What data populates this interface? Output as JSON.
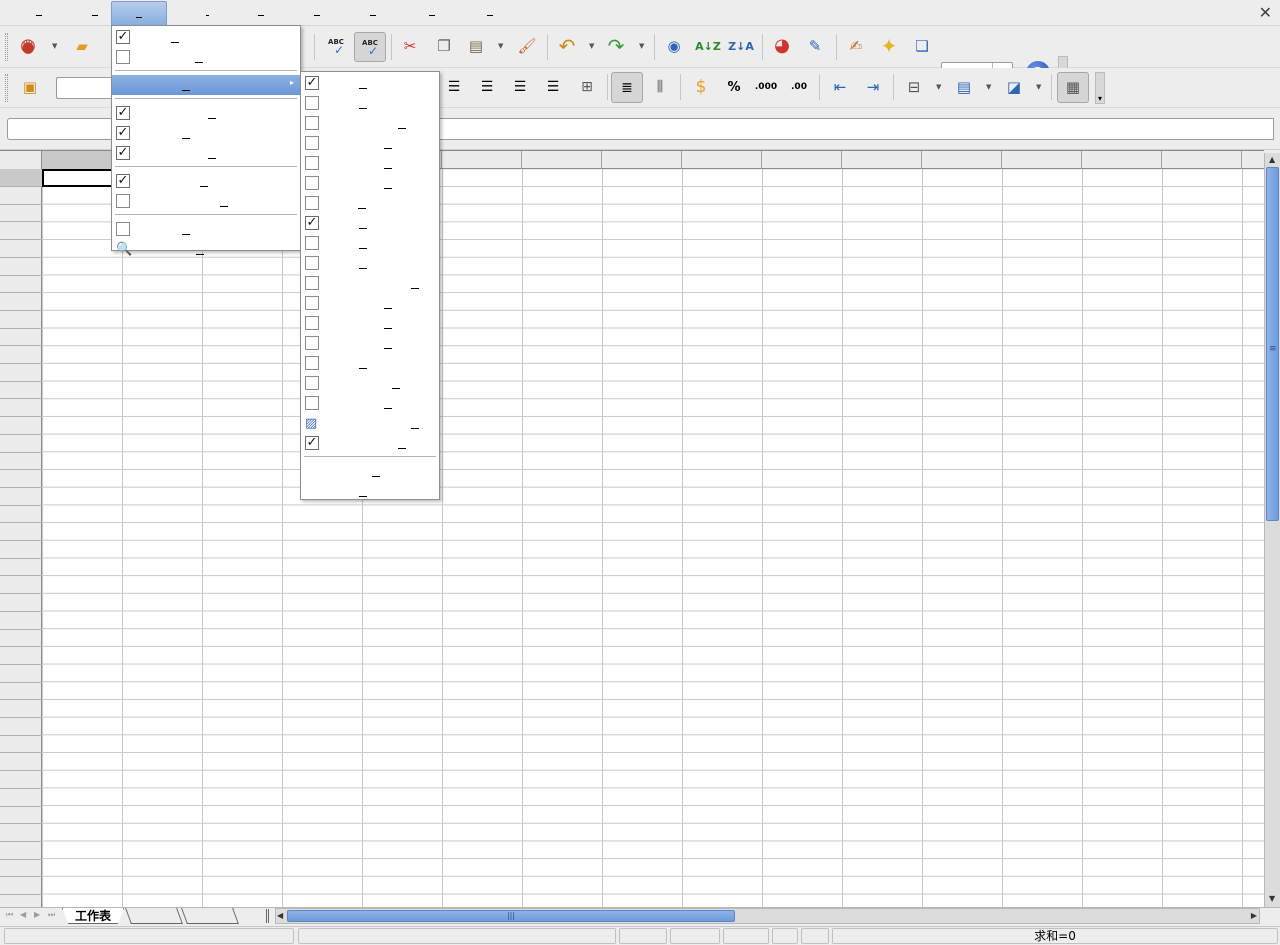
{
  "app": {
    "menu_labels": [
      "",
      "",
      "",
      "",
      "",
      "",
      "",
      "",
      ""
    ],
    "active_menu_index": 2
  },
  "view_menu": {
    "items": [
      {
        "label": "",
        "checked": true
      },
      {
        "label": "",
        "checked": false
      },
      {
        "label": "",
        "submenu": true,
        "highlighted": true
      },
      {
        "label": "",
        "checked": true
      },
      {
        "label": "",
        "checked": true
      },
      {
        "label": "",
        "checked": true
      },
      {
        "label": "",
        "checked": true
      },
      {
        "label": "",
        "checked": false
      },
      {
        "label": "",
        "checked": false
      },
      {
        "label": "",
        "icon": "magnifier-icon"
      }
    ]
  },
  "toolbars_menu": {
    "items": [
      {
        "label": "",
        "checked": true
      },
      {
        "label": "",
        "checked": false
      },
      {
        "label": "",
        "checked": false
      },
      {
        "label": "",
        "checked": false
      },
      {
        "label": "",
        "checked": false
      },
      {
        "label": "",
        "checked": false
      },
      {
        "label": "",
        "checked": false
      },
      {
        "label": "",
        "checked": true
      },
      {
        "label": "",
        "checked": false
      },
      {
        "label": "",
        "checked": false
      },
      {
        "label": "",
        "checked": false
      },
      {
        "label": "",
        "checked": false
      },
      {
        "label": "",
        "checked": false
      },
      {
        "label": "",
        "checked": false
      },
      {
        "label": "",
        "checked": false
      },
      {
        "label": "",
        "checked": false
      },
      {
        "label": "",
        "checked": false
      },
      {
        "label": "",
        "icon": "image-icon"
      },
      {
        "label": "",
        "checked": true
      },
      {
        "label": ""
      },
      {
        "label": ""
      }
    ]
  },
  "sheet": {
    "tabs": [
      "工作表",
      "",
      ""
    ],
    "active_tab": "工作表"
  },
  "inputs": {
    "zoom_value": "",
    "font_name": "",
    "name_box": "",
    "formula": ""
  },
  "status": {
    "sum": "求和=0"
  },
  "colors": {
    "menu_highlight": "#7aa3dc",
    "scroll_thumb": "#7ea7e1",
    "grid_line": "#c9c9c9"
  }
}
